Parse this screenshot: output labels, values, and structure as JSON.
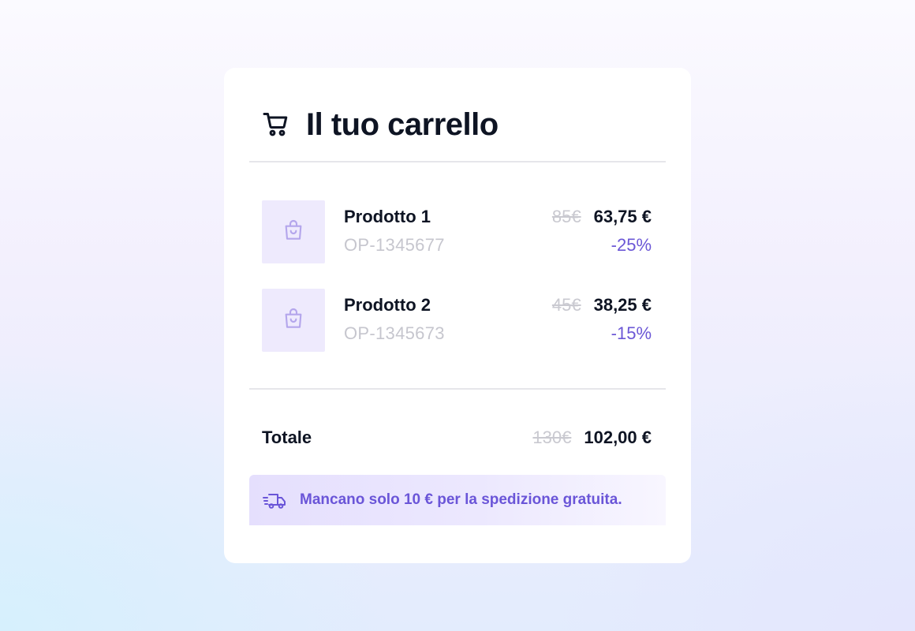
{
  "cart": {
    "title": "Il tuo carrello",
    "icon": "shopping-cart-icon",
    "items": [
      {
        "name": "Prodotto 1",
        "sku": "OP-1345677",
        "old_price": "85€",
        "price": "63,75 €",
        "discount": "-25%",
        "icon": "shopping-bag-icon"
      },
      {
        "name": "Prodotto 2",
        "sku": "OP-1345673",
        "old_price": "45€",
        "price": "38,25 €",
        "discount": "-15%",
        "icon": "shopping-bag-icon"
      }
    ],
    "total": {
      "label": "Totale",
      "old_price": "130€",
      "price": "102,00 €"
    },
    "shipping_notice": {
      "icon": "fast-delivery-truck-icon",
      "text": "Mancano solo 10 € per la spedizione gratuita."
    }
  },
  "colors": {
    "accent": "#6b57d6",
    "text": "#0e1423",
    "muted": "#c6c6ce",
    "thumb_bg": "#eeeafd"
  }
}
